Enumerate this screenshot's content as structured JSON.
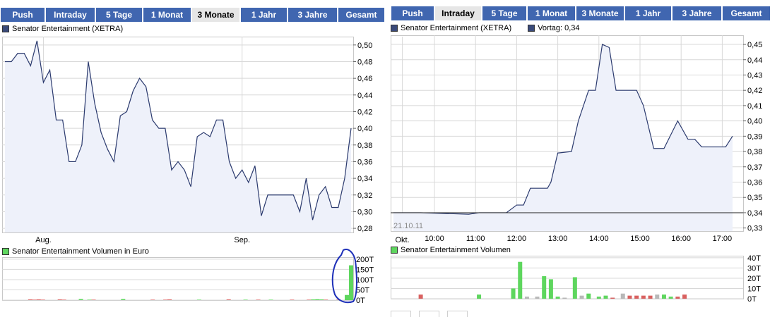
{
  "colors": {
    "tab_bg": "#4066b0",
    "tab_active_bg": "#e6e6e6",
    "line": "#2b3a6e",
    "area_fill": "#eef1fa",
    "grid": "#d8d8d8",
    "vol_up": "#5ed65e",
    "vol_down": "#d9605f",
    "vol_neutral": "#b8b8b8",
    "annotation": "#1d2fb8"
  },
  "left": {
    "tabs": [
      {
        "label": "Push",
        "active": false
      },
      {
        "label": "Intraday",
        "active": false
      },
      {
        "label": "5 Tage",
        "active": false
      },
      {
        "label": "1 Monat",
        "active": false
      },
      {
        "label": "3 Monate",
        "active": true
      },
      {
        "label": "1 Jahr",
        "active": false
      },
      {
        "label": "3 Jahre",
        "active": false
      },
      {
        "label": "Gesamt",
        "active": false
      }
    ],
    "price_legend": "Senator Entertainment (XETRA)",
    "volume_legend": "Senator Entertainment Volumen in Euro"
  },
  "right": {
    "tabs": [
      {
        "label": "Push",
        "active": false
      },
      {
        "label": "Intraday",
        "active": true
      },
      {
        "label": "5 Tage",
        "active": false
      },
      {
        "label": "1 Monat",
        "active": false
      },
      {
        "label": "3 Monate",
        "active": false
      },
      {
        "label": "1 Jahr",
        "active": false
      },
      {
        "label": "3 Jahre",
        "active": false
      },
      {
        "label": "Gesamt",
        "active": false
      }
    ],
    "price_legend": "Senator Entertainment (XETRA)",
    "vortag_legend": "Vortag: 0,34",
    "volume_legend": "Senator Entertainment Volumen",
    "date_label": "21.10.11"
  },
  "chart_data": [
    {
      "type": "area",
      "title": "Senator Entertainment (XETRA)",
      "y_ticks": [
        "0,28",
        "0,30",
        "0,32",
        "0,34",
        "0,36",
        "0,38",
        "0,40",
        "0,42",
        "0,44",
        "0,46",
        "0,48",
        "0,50"
      ],
      "ylim": [
        0.275,
        0.51
      ],
      "x_tick_labels": [
        "Aug.",
        "Sep.",
        "Okt."
      ],
      "x_tick_index": [
        6,
        37,
        62
      ],
      "grid": true,
      "values": [
        0.48,
        0.48,
        0.49,
        0.49,
        0.475,
        0.505,
        0.455,
        0.47,
        0.41,
        0.41,
        0.36,
        0.36,
        0.38,
        0.48,
        0.43,
        0.395,
        0.375,
        0.36,
        0.415,
        0.42,
        0.445,
        0.46,
        0.45,
        0.41,
        0.4,
        0.4,
        0.35,
        0.36,
        0.35,
        0.33,
        0.39,
        0.395,
        0.39,
        0.41,
        0.41,
        0.36,
        0.34,
        0.35,
        0.335,
        0.355,
        0.295,
        0.32,
        0.32,
        0.32,
        0.32,
        0.32,
        0.3,
        0.34,
        0.29,
        0.32,
        0.33,
        0.305,
        0.305,
        0.34,
        0.4
      ]
    },
    {
      "type": "bar",
      "title": "Senator Entertainment Volumen in Euro",
      "y_ticks": [
        "0T",
        "50T",
        "100T",
        "150T",
        "200T"
      ],
      "ylim": [
        0,
        210
      ],
      "values": [
        0,
        0,
        0,
        0,
        0,
        0,
        3,
        2,
        3,
        2,
        0,
        0,
        0,
        3,
        2,
        0,
        0,
        0,
        5,
        0,
        2,
        2,
        0,
        0,
        0,
        0,
        0,
        0,
        5,
        0,
        0,
        0,
        0,
        0,
        0,
        2,
        0,
        0,
        2,
        3,
        0,
        0,
        0,
        0,
        0,
        0,
        2,
        0,
        0,
        0,
        0,
        0,
        0,
        3,
        0,
        0,
        0,
        2,
        0,
        0,
        2,
        0,
        0,
        2,
        0,
        0,
        0,
        0,
        2,
        0,
        0,
        0,
        2,
        3,
        4,
        3,
        2,
        0,
        0,
        2,
        0,
        25,
        170
      ],
      "direction": [
        "n",
        "n",
        "n",
        "n",
        "n",
        "n",
        "d",
        "d",
        "d",
        "d",
        "n",
        "n",
        "n",
        "d",
        "d",
        "n",
        "n",
        "n",
        "u",
        "n",
        "u",
        "d",
        "n",
        "n",
        "n",
        "n",
        "n",
        "n",
        "u",
        "n",
        "n",
        "n",
        "n",
        "n",
        "n",
        "d",
        "n",
        "n",
        "d",
        "d",
        "n",
        "n",
        "n",
        "n",
        "n",
        "n",
        "u",
        "n",
        "n",
        "n",
        "n",
        "n",
        "n",
        "d",
        "n",
        "n",
        "n",
        "u",
        "n",
        "n",
        "d",
        "n",
        "n",
        "u",
        "n",
        "n",
        "n",
        "n",
        "d",
        "n",
        "n",
        "n",
        "d",
        "u",
        "u",
        "u",
        "d",
        "n",
        "n",
        "d",
        "n",
        "u",
        "u"
      ]
    },
    {
      "type": "area",
      "title": "Senator Entertainment (XETRA)",
      "previous_close": 0.34,
      "y_ticks": [
        "0,33",
        "0,34",
        "0,35",
        "0,36",
        "0,37",
        "0,38",
        "0,39",
        "0,40",
        "0,41",
        "0,42",
        "0,43",
        "0,44",
        "0,45"
      ],
      "ylim": [
        0.328,
        0.456
      ],
      "x_tick_labels": [
        "10:00",
        "11:00",
        "12:00",
        "13:00",
        "14:00",
        "15:00",
        "16:00",
        "17:00"
      ],
      "x": [
        "09:00",
        "09:40",
        "10:50",
        "11:05",
        "11:45",
        "12:00",
        "12:10",
        "12:20",
        "12:45",
        "12:50",
        "13:00",
        "13:20",
        "13:30",
        "13:45",
        "13:55",
        "14:05",
        "14:15",
        "14:25",
        "14:35",
        "14:55",
        "15:05",
        "15:20",
        "15:35",
        "15:55",
        "16:10",
        "16:20",
        "16:30",
        "17:05",
        "17:15"
      ],
      "values": [
        0.34,
        0.34,
        0.339,
        0.34,
        0.34,
        0.345,
        0.345,
        0.356,
        0.356,
        0.36,
        0.379,
        0.38,
        0.4,
        0.42,
        0.42,
        0.45,
        0.448,
        0.42,
        0.42,
        0.42,
        0.41,
        0.382,
        0.382,
        0.4,
        0.388,
        0.388,
        0.383,
        0.383,
        0.39
      ]
    },
    {
      "type": "bar",
      "title": "Senator Entertainment Volumen",
      "y_ticks": [
        "0T",
        "10T",
        "20T",
        "30T",
        "40T"
      ],
      "ylim": [
        0,
        42
      ],
      "x": [
        "09:40",
        "11:05",
        "11:55",
        "12:05",
        "12:15",
        "12:30",
        "12:40",
        "12:50",
        "13:00",
        "13:10",
        "13:25",
        "13:35",
        "13:45",
        "14:00",
        "14:10",
        "14:20",
        "14:35",
        "14:45",
        "14:55",
        "15:05",
        "15:15",
        "15:25",
        "15:35",
        "15:45",
        "15:55",
        "16:05"
      ],
      "values": [
        4,
        4,
        10,
        36,
        2,
        2,
        22,
        19,
        2,
        1,
        21,
        3,
        5,
        2,
        3,
        1,
        5,
        3,
        3,
        3,
        3,
        4,
        4,
        2,
        2,
        4
      ],
      "direction": [
        "d",
        "u",
        "u",
        "u",
        "n",
        "n",
        "u",
        "u",
        "u",
        "n",
        "u",
        "n",
        "u",
        "u",
        "u",
        "d",
        "n",
        "d",
        "d",
        "d",
        "d",
        "n",
        "u",
        "u",
        "d",
        "d"
      ]
    }
  ]
}
